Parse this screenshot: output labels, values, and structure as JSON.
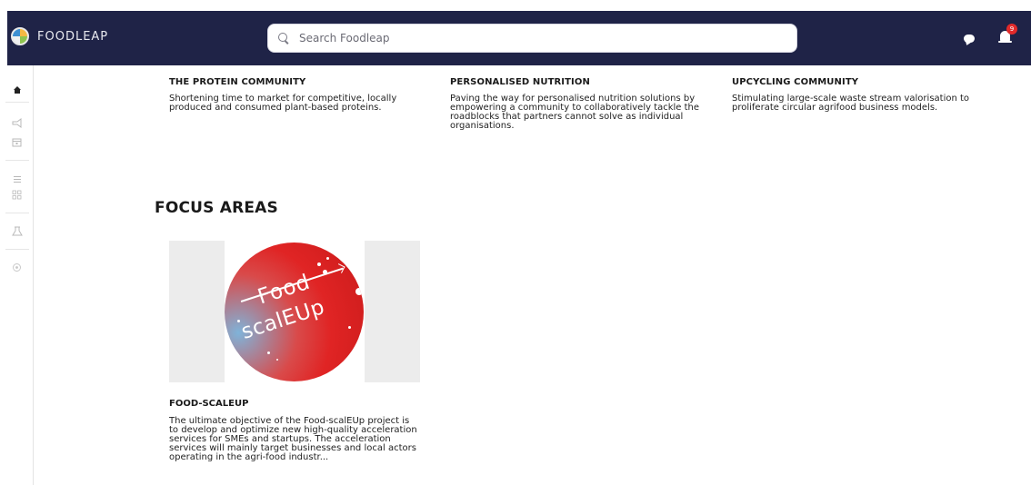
{
  "header": {
    "brand_name": "FOODLEAP",
    "search_placeholder": "Search Foodleap",
    "notification_count": "9"
  },
  "communities": [
    {
      "title": "THE PROTEIN COMMUNITY",
      "description": "Shortening time to market for competitive, locally produced and consumed plant-based proteins."
    },
    {
      "title": "PERSONALISED NUTRITION",
      "description": "Paving the way for personalised nutrition solutions by empowering a community to collaboratively tackle the roadblocks that partners cannot solve as individual organisations."
    },
    {
      "title": "UPCYCLING COMMUNITY",
      "description": "Stimulating large-scale waste stream valorisation to proliferate circular agrifood business models."
    }
  ],
  "focus_areas": {
    "heading": "FOCUS AREAS",
    "items": [
      {
        "logo_text_top": "Food",
        "logo_text_bottom": "scalEUp",
        "title": "FOOD-SCALEUP",
        "description": "The ultimate objective of the Food-scalEUp project is to develop and optimize new high-quality acceleration services for SMEs and startups. The acceleration services will mainly target businesses and local actors operating in the agri-food industr..."
      }
    ]
  },
  "colors": {
    "header_bg": "#1f2347",
    "badge": "#e32a2a",
    "logo_red": "#e02424",
    "logo_blue": "#7fb3d9"
  },
  "icons": {
    "sidebar": [
      "home-icon",
      "megaphone-icon",
      "calendar-icon",
      "list-icon",
      "grid-icon",
      "lab-icon",
      "settings-icon"
    ],
    "header": [
      "search-icon",
      "chat-icon",
      "bell-icon"
    ]
  }
}
